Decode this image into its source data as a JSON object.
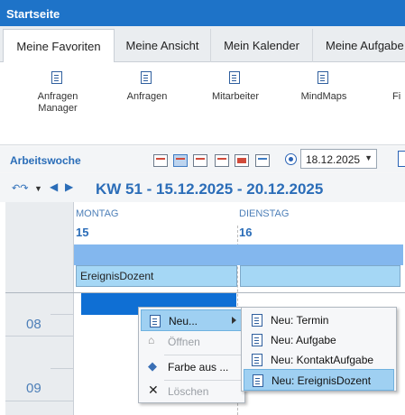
{
  "window": {
    "title": "Startseite"
  },
  "tabs": [
    {
      "label": "Meine Favoriten",
      "active": true
    },
    {
      "label": "Meine Ansicht"
    },
    {
      "label": "Mein Kalender"
    },
    {
      "label": "Meine Aufgabe"
    }
  ],
  "ribbon": [
    {
      "label": "Anfragen Manager",
      "icon": "document-icon"
    },
    {
      "label": "Anfragen",
      "icon": "document-icon"
    },
    {
      "label": "Mitarbeiter",
      "icon": "document-icon"
    },
    {
      "label": "MindMaps",
      "icon": "document-icon"
    },
    {
      "label": "Fi",
      "icon": "document-icon"
    }
  ],
  "toolbar": {
    "view_label": "Arbeitswoche",
    "date": "18.12.2025"
  },
  "nav": {
    "week_title": "KW 51 - 15.12.2025 - 20.12.2025"
  },
  "calendar": {
    "days": [
      {
        "name": "MONTAG",
        "num": "15"
      },
      {
        "name": "DIENSTAG",
        "num": "16"
      }
    ],
    "hours": [
      "08",
      "09"
    ],
    "event_label": "EreignisDozent"
  },
  "context_menu": {
    "items": [
      {
        "label": "Neu...",
        "icon": "new-document-icon",
        "highlighted": true,
        "submenu": true
      },
      {
        "label": "Öffnen",
        "icon": "open-folder-icon",
        "disabled": true
      },
      {
        "label": "Farbe aus ...",
        "icon": "paint-bucket-icon"
      },
      {
        "label": "Löschen",
        "icon": "delete-x-icon",
        "disabled": true
      }
    ]
  },
  "submenu": {
    "items": [
      {
        "label": "Neu: Termin",
        "icon": "new-document-icon"
      },
      {
        "label": "Neu: Aufgabe",
        "icon": "new-document-icon"
      },
      {
        "label": "Neu: KontaktAufgabe",
        "icon": "new-document-icon"
      },
      {
        "label": "Neu: EreignisDozent",
        "icon": "new-document-icon",
        "highlighted": true
      }
    ]
  },
  "colors": {
    "accent": "#1e73c8",
    "highlight": "#9fd0f2",
    "selection": "#0f6fd4"
  }
}
